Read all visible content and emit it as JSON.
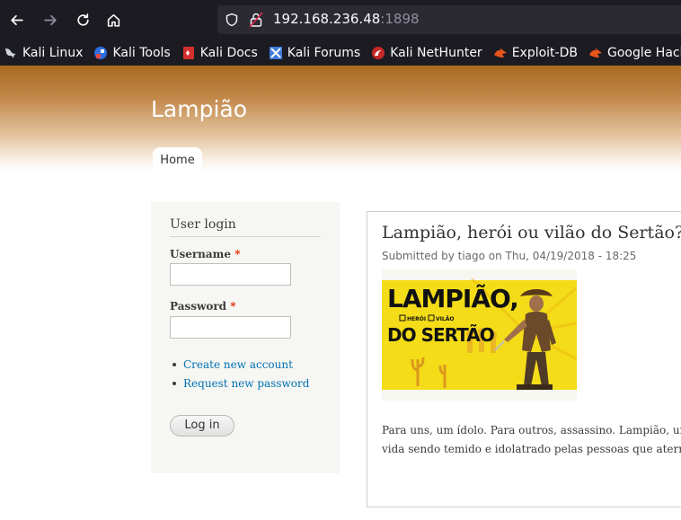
{
  "browser": {
    "url_host": "192.168.236.48",
    "url_port": ":1898",
    "bookmarks": [
      {
        "label": "Kali Linux",
        "icon": "kali-dragon-icon"
      },
      {
        "label": "Kali Tools",
        "icon": "kali-tools-icon"
      },
      {
        "label": "Kali Docs",
        "icon": "kali-docs-icon"
      },
      {
        "label": "Kali Forums",
        "icon": "kali-forums-icon"
      },
      {
        "label": "Kali NetHunter",
        "icon": "kali-nethunter-icon"
      },
      {
        "label": "Exploit-DB",
        "icon": "exploit-db-icon"
      },
      {
        "label": "Google Hacking DB",
        "icon": "ghdb-icon"
      }
    ]
  },
  "site": {
    "name": "Lampião",
    "nav": {
      "home": "Home"
    }
  },
  "login": {
    "title": "User login",
    "username_label": "Username",
    "password_label": "Password",
    "required_mark": "*",
    "links": [
      "Create new account",
      "Request new password"
    ],
    "submit": "Log in"
  },
  "article": {
    "title": "Lampião, herói ou vilão do Sertão?",
    "meta": "Submitted by tiago on Thu, 04/19/2018 - 18:25",
    "image": {
      "line1": "LAMPIÃO,",
      "opt1": "HERÓI",
      "opt2": "VILÃO",
      "line2": "DO SERTÃO"
    },
    "body_line1": "Para uns, um ídolo. Para outros, assassino. Lampião, uma das mais importantes figuras do cangaço,",
    "body_line2": "vida sendo temido e idolatrado pelas pessoas que aterrorizava."
  },
  "colors": {
    "chrome_bg": "#1c1b22",
    "url_bg": "#2b2a33",
    "header_brown": "#a76a1e",
    "link_blue": "#0071b3",
    "required_red": "#e32700",
    "sidebar_bg": "#f6f6f2"
  }
}
